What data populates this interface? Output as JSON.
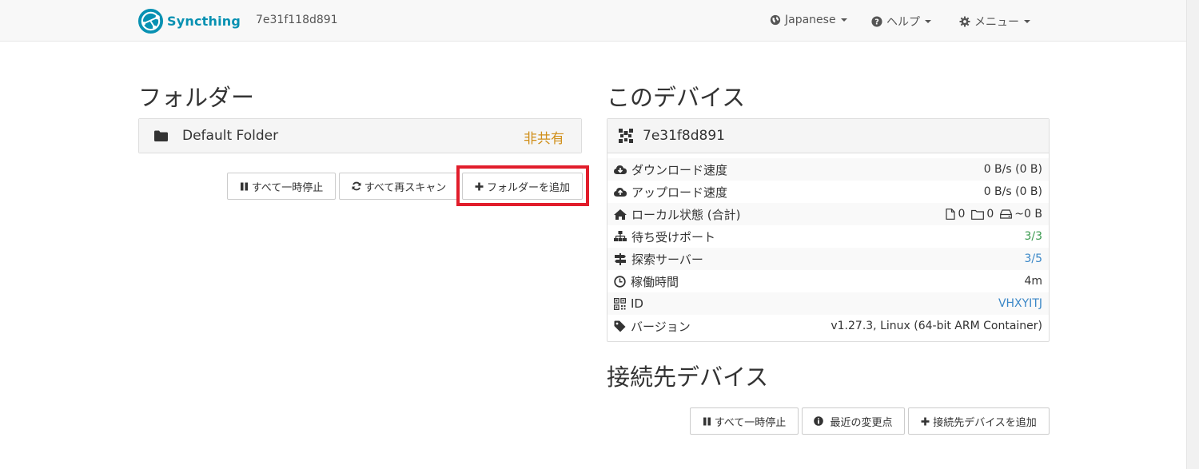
{
  "navbar": {
    "brand": "Syncthing",
    "device_id": "7e31f118d891",
    "language": "Japanese",
    "help": "ヘルプ",
    "menu": "メニュー"
  },
  "folders": {
    "title": "フォルダー",
    "items": [
      {
        "name": "Default Folder",
        "status": "非共有"
      }
    ],
    "buttons": {
      "pause_all": "すべて一時停止",
      "rescan_all": "すべて再スキャン",
      "add_folder": "フォルダーを追加"
    }
  },
  "this_device": {
    "title": "このデバイス",
    "name": "7e31f8d891",
    "rows": {
      "download_label": "ダウンロード速度",
      "download_value": "0 B/s (0 B)",
      "upload_label": "アップロード速度",
      "upload_value": "0 B/s (0 B)",
      "local_state_label": "ローカル状態 (合計)",
      "local_files": "0",
      "local_dirs": "0",
      "local_size": "~0 B",
      "listeners_label": "待ち受けポート",
      "listeners_value": "3/3",
      "discovery_label": "探索サーバー",
      "discovery_value": "3/5",
      "uptime_label": "稼働時間",
      "uptime_value": "4m",
      "id_label": "ID",
      "id_value": "VHXYITJ",
      "version_label": "バージョン",
      "version_value": "v1.27.3, Linux (64-bit ARM Container)"
    }
  },
  "remote_devices": {
    "title": "接続先デバイス",
    "buttons": {
      "pause_all": "すべて一時停止",
      "recent_changes": "最近の変更点",
      "add_device": "接続先デバイスを追加"
    }
  },
  "colors": {
    "accent": "#0891b2",
    "unshared": "#d08f1a",
    "ok": "#3c9a50",
    "link": "#3a87c7",
    "highlight": "#e11d2b"
  }
}
